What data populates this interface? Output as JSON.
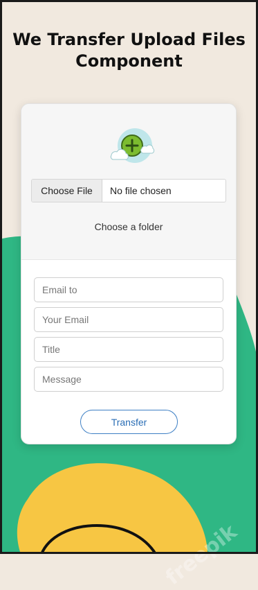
{
  "header": {
    "title_line1": "We Transfer Upload Files",
    "title_line2": "Component"
  },
  "upload": {
    "icon": "cloud-plus-icon",
    "choose_file_label": "Choose File",
    "file_status": "No file chosen",
    "folder_link": "Choose a folder"
  },
  "form": {
    "email_to_placeholder": "Email to",
    "your_email_placeholder": "Your Email",
    "title_placeholder": "Title",
    "message_placeholder": "Message",
    "transfer_label": "Transfer"
  },
  "watermark": {
    "logo_text": "freepik"
  },
  "colors": {
    "beige_bg": "#f1e9df",
    "green_blob": "#2fb784",
    "yellow_blob": "#f7c643",
    "accent_blue": "#2a6db5",
    "icon_green": "#7cbc2f"
  }
}
